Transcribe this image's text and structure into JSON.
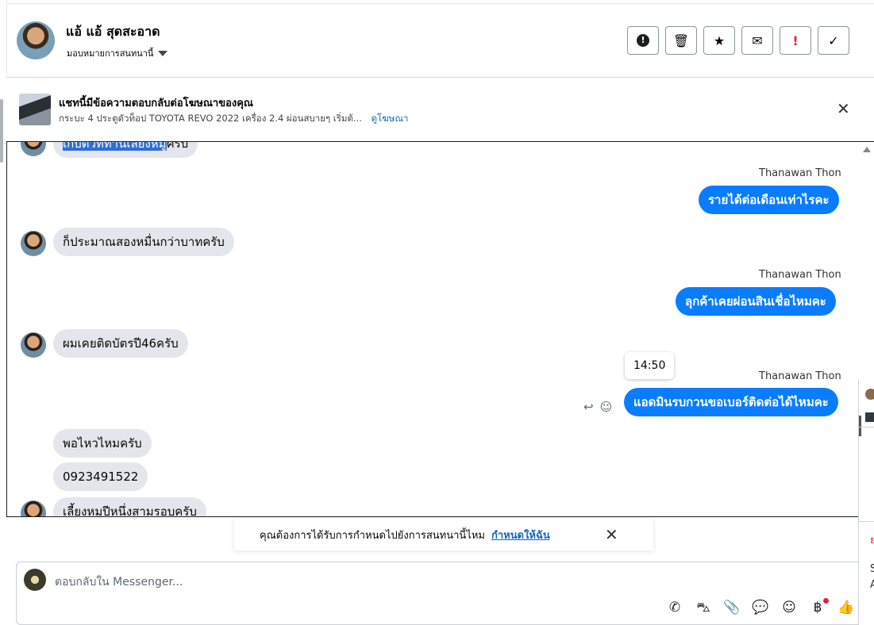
{
  "header": {
    "contact_name": "แอ้ แอ้ สุดสะอาด",
    "assign_label": "มอบหมายการสนทนานี้",
    "buttons": [
      {
        "name": "spam-button",
        "icon": "●!",
        "color": "#1c1e21"
      },
      {
        "name": "delete-button",
        "icon": "🗑",
        "color": "#1c1e21"
      },
      {
        "name": "star-button",
        "icon": "★",
        "color": "#1c1e21"
      },
      {
        "name": "mark-unread-button",
        "icon": "✉",
        "color": "#1c1e21"
      },
      {
        "name": "follow-up-button",
        "icon": "!",
        "color": "#e41e3f"
      },
      {
        "name": "mark-done-button",
        "icon": "✓",
        "color": "#1c1e21"
      }
    ]
  },
  "ad": {
    "title": "แชทนี้มีข้อความตอบกลับต่อโฆษณาของคุณ",
    "subtitle": "กระบะ 4 ประตูตัวท็อป TOYOTA REVO 2022 เครื่อง 2.4 ผ่อนสบายๆ เริ่มต้...",
    "link": "ดูโฆษณา"
  },
  "messages": {
    "partial_top": {
      "highlighted": "เก็บตัวที่ท่านเลี้ยงหมู",
      "rest": "ครับ"
    },
    "sender_name": "Thanawan Thon",
    "out1": "รายได้ต่อเดือนเท่าไรคะ",
    "in1": "ก็ประมาณสองหมื่นกว่าบาทครับ",
    "out2": "ลุกค้าเคยผ่อนสินเชื่อไหมคะ",
    "in2": "ผมเคยติดบัตรปี46ครับ",
    "tooltip_time": "14:50",
    "out3": "แอดมินรบกวนขอเบอร์ติดต่อได้ไหมคะ",
    "in3": "พอไหวไหมครับ",
    "in4": "0923491522",
    "in5": "เลี้ยงหมูปีหนึ่งสามรอบครับ"
  },
  "toast": {
    "text": "คุณต้องการได้รับการกำหนดไปยังการสนทนานี้ไหม",
    "link": "กำหนดให้ฉัน"
  },
  "composer": {
    "placeholder": "ตอบกลับใน Messenger..."
  },
  "right_panel": {
    "text1": "ย",
    "text2": "S",
    "text3": "A"
  },
  "colors": {
    "accent": "#0a7cff",
    "link": "#1565c0",
    "incoming_bubble": "#e4e6eb",
    "alert": "#e41e3f"
  }
}
